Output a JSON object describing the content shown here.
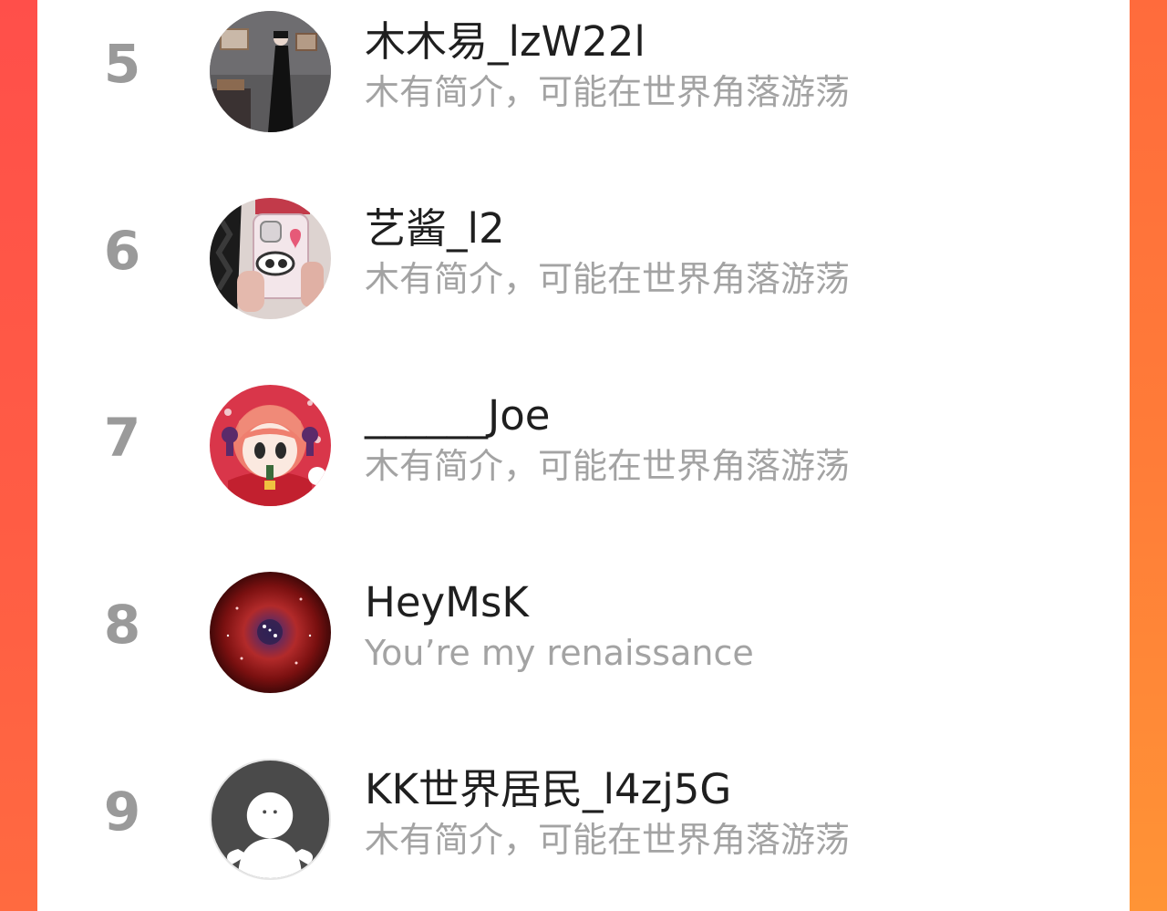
{
  "ranking": {
    "rows": [
      {
        "rank": "5",
        "name": "木木易_lzW22l",
        "bio": "木有简介，可能在世界角落游荡",
        "avatar_icon": "portrait-photo-woman-black-dress-icon"
      },
      {
        "rank": "6",
        "name": "艺酱_l2",
        "bio": "木有简介，可能在世界角落游荡",
        "avatar_icon": "photo-phone-case-pink-icon"
      },
      {
        "rank": "7",
        "name": "______Joe",
        "bio": "木有简介，可能在世界角落游荡",
        "avatar_icon": "anime-red-hair-girl-icon"
      },
      {
        "rank": "8",
        "name": "HeyMsK",
        "bio": "You’re my renaissance",
        "avatar_icon": "red-nebula-space-icon"
      },
      {
        "rank": "9",
        "name": "KK世界居民_l4zj5G",
        "bio": "木有简介，可能在世界角落游荡",
        "avatar_icon": "default-person-silhouette-icon"
      }
    ]
  },
  "colors": {
    "background_accent": "#ff6a3e",
    "rank_gray": "#9a9a9a",
    "name_text": "#1f1f1f",
    "bio_text": "#a3a3a3"
  }
}
